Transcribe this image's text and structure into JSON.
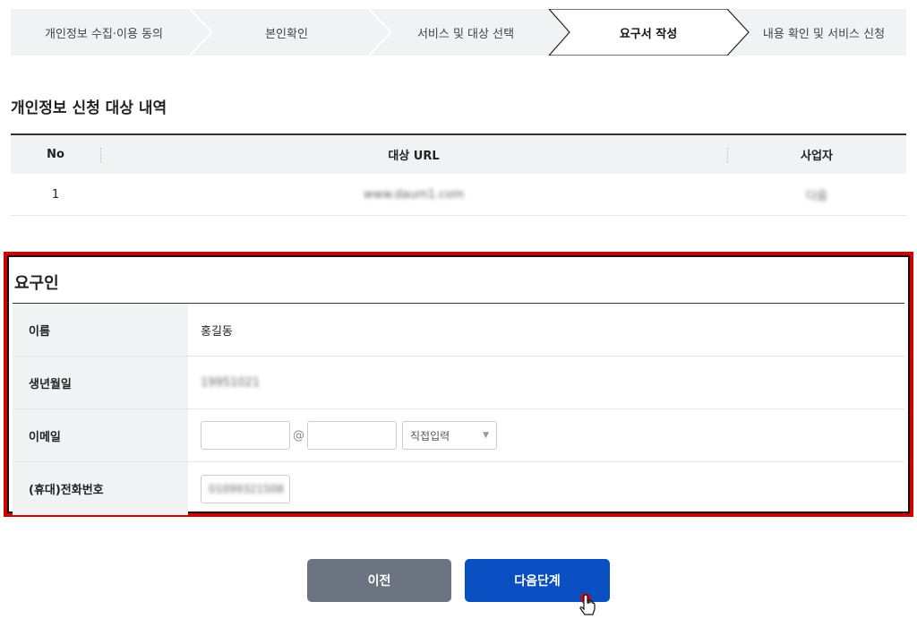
{
  "steps": [
    {
      "label": "개인정보 수집·이용 동의",
      "active": false
    },
    {
      "label": "본인확인",
      "active": false
    },
    {
      "label": "서비스 및 대상 선택",
      "active": false
    },
    {
      "label": "요구서 작성",
      "active": true
    },
    {
      "label": "내용 확인 및 서비스 신청",
      "active": false
    }
  ],
  "target": {
    "title": "개인정보 신청 대상 내역",
    "columns": [
      "No",
      "대상 URL",
      "사업자"
    ],
    "rows": [
      {
        "no": "1",
        "url": "www.daum1.com",
        "business": "다음"
      }
    ]
  },
  "requester": {
    "title": "요구인",
    "name_label": "이름",
    "name_value": "홍길동",
    "birth_label": "생년월일",
    "birth_value": "19951021",
    "email_label": "이메일",
    "email_local": "",
    "email_at": "@",
    "email_domain": "",
    "email_domain_select": "직접입력",
    "phone_label": "(휴대)전화번호",
    "phone_value": "01099321508"
  },
  "buttons": {
    "prev": "이전",
    "next": "다음단계"
  },
  "colors": {
    "highlight_border": "#d40000",
    "next_button": "#0a4fc2",
    "prev_button": "#6b7480"
  }
}
